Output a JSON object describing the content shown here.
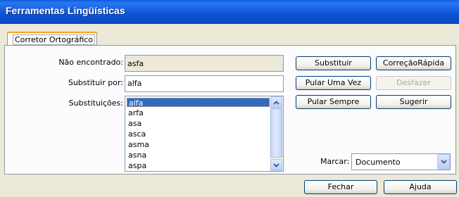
{
  "window": {
    "title": "Ferramentas Lingüísticas"
  },
  "tabs": [
    {
      "label": "Corretor Ortográfico"
    }
  ],
  "not_found": {
    "label": "Não encontrado:",
    "value": "asfa"
  },
  "replace_with": {
    "label": "Substituir por:",
    "value": "alfa"
  },
  "suggestions": {
    "label": "Substituições:",
    "items": [
      "alfa",
      "arfa",
      "asa",
      "asca",
      "asma",
      "asna",
      "aspa"
    ],
    "selected": "alfa"
  },
  "buttons": {
    "replace": "Substituir",
    "autocorrect": "CorreçãoRápida",
    "skip_once": "Pular Uma Vez",
    "undo": "Desfazer",
    "skip_always": "Pular Sempre",
    "suggest": "Sugerir",
    "close": "Fechar",
    "help": "Ajuda"
  },
  "mark": {
    "label": "Marcar:",
    "value": "Documento"
  },
  "colors": {
    "title_bar": "#0a5be0",
    "selection": "#316ac5",
    "tab_highlight": "#f5a623",
    "window_bg": "#ece9d8"
  }
}
